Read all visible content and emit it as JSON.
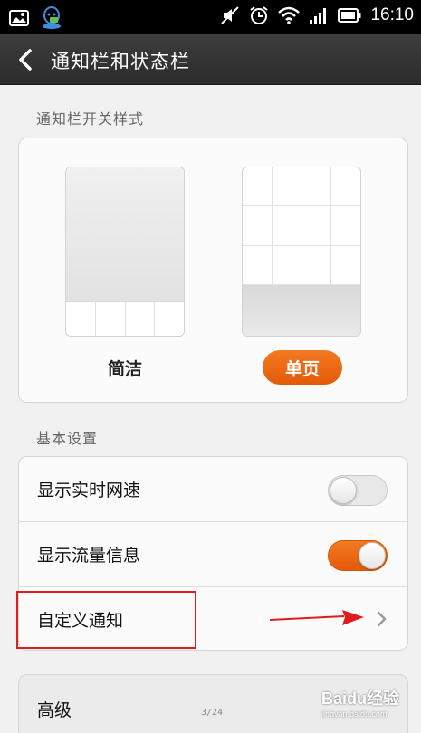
{
  "status_bar": {
    "time": "16:10",
    "icons": [
      "image-icon",
      "qq-icon",
      "mute-icon",
      "alarm-icon",
      "wifi-icon",
      "signal-icon",
      "battery-icon"
    ]
  },
  "header": {
    "title": "通知栏和状态栏",
    "back_icon": "chevron-left-icon"
  },
  "switch_style": {
    "section_title": "通知栏开关样式",
    "options": [
      {
        "label": "简洁",
        "selected": false
      },
      {
        "label": "单页",
        "selected": true
      }
    ]
  },
  "basic_settings": {
    "section_title": "基本设置",
    "items": [
      {
        "label": "显示实时网速",
        "control": "toggle",
        "on": false
      },
      {
        "label": "显示流量信息",
        "control": "toggle",
        "on": true
      },
      {
        "label": "自定义通知",
        "control": "chevron"
      }
    ]
  },
  "advanced": {
    "label": "高级"
  },
  "page_indicator": "3/24",
  "watermark": {
    "main": "Baidu经验",
    "sub": "jingyan.baidu.com"
  },
  "colors": {
    "accent": "#e96512",
    "highlight": "#e21c1c"
  }
}
